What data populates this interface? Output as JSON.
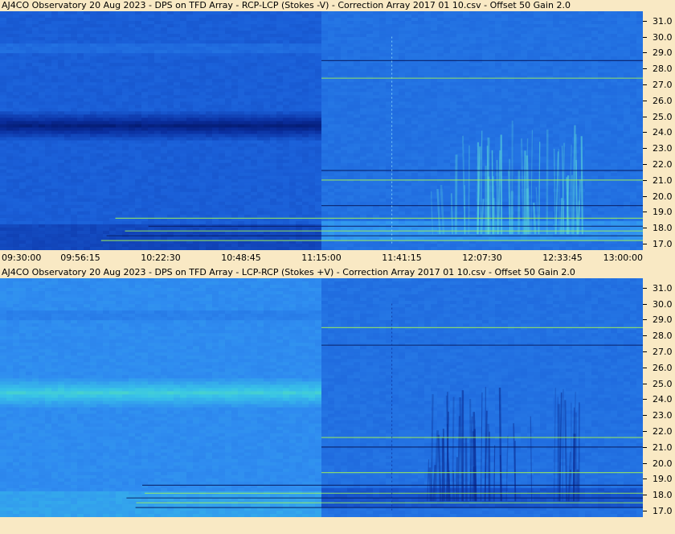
{
  "chart_data": [
    {
      "type": "heatmap",
      "title": "AJ4CO Observatory 20 Aug 2023  -  DPS on TFD Array  -  RCP-LCP (Stokes -V)  -  Correction Array 2017 01 10.csv  -  Offset 50  Gain 2.0",
      "x_tick_labels": [
        "09:30:00",
        "09:56:15",
        "10:22:30",
        "10:48:45",
        "11:15:00",
        "11:41:15",
        "12:07:30",
        "12:33:45",
        "13:00:00"
      ],
      "x_range": [
        "09:30:00",
        "13:00:00"
      ],
      "y_tick_labels": [
        "31.0",
        "30.0",
        "29.0",
        "28.0",
        "27.0",
        "26.0",
        "25.0",
        "24.0",
        "23.0",
        "22.0",
        "21.0",
        "20.0",
        "19.0",
        "18.0",
        "17.0"
      ],
      "y_range": [
        16.6,
        31.6
      ],
      "colormap": [
        "#00105a",
        "#0a2fa0",
        "#1a5fd8",
        "#2f8cf0",
        "#38c4e8",
        "#66ee99",
        "#d8f050"
      ],
      "features": [
        {
          "kind": "dark-band",
          "freq": [
            24.0,
            25.0
          ],
          "time": [
            "09:30:00",
            "11:02:00"
          ]
        },
        {
          "kind": "bright-band",
          "freq": [
            17.4,
            18.2
          ],
          "time": [
            "11:15:00",
            "13:00:00"
          ]
        },
        {
          "kind": "storm",
          "freq": [
            17.6,
            24.8
          ],
          "time": [
            "11:50:00",
            "12:40:00"
          ]
        }
      ]
    },
    {
      "type": "heatmap",
      "title": "AJ4CO Observatory 20 Aug 2023  -  DPS on TFD Array  -  LCP-RCP (Stokes +V)  -  Correction Array 2017 01 10.csv  -  Offset 50  Gain 2.0",
      "x_tick_labels": [],
      "x_range": [
        "09:30:00",
        "13:00:00"
      ],
      "y_tick_labels": [
        "31.0",
        "30.0",
        "29.0",
        "28.0",
        "27.0",
        "26.0",
        "25.0",
        "24.0",
        "23.0",
        "22.0",
        "21.0",
        "20.0",
        "19.0",
        "18.0",
        "17.0"
      ],
      "y_range": [
        16.6,
        31.6
      ],
      "colormap": [
        "#00105a",
        "#0a2fa0",
        "#1a5fd8",
        "#2f8cf0",
        "#38c4e8",
        "#66ee99",
        "#d8f050"
      ],
      "features": [
        {
          "kind": "bright-band",
          "freq": [
            24.0,
            25.0
          ],
          "time": [
            "09:30:00",
            "11:02:00"
          ]
        },
        {
          "kind": "dark-band",
          "freq": [
            17.4,
            18.2
          ],
          "time": [
            "11:15:00",
            "13:00:00"
          ]
        },
        {
          "kind": "storm",
          "freq": [
            17.6,
            24.8
          ],
          "time": [
            "11:50:00",
            "12:40:00"
          ]
        }
      ]
    }
  ]
}
